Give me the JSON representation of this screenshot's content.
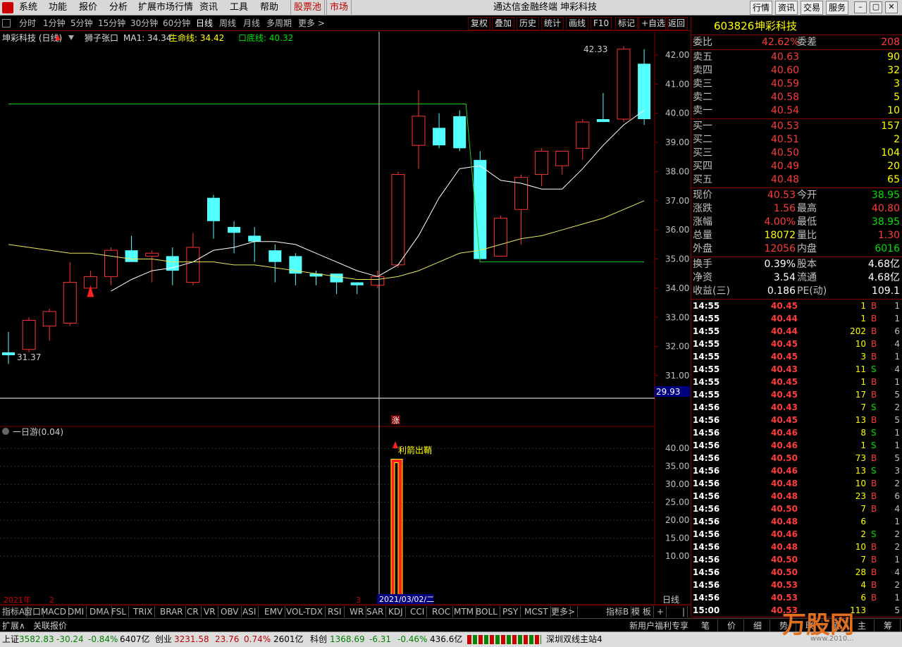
{
  "menu": {
    "items": [
      "系统",
      "功能",
      "报价",
      "分析",
      "扩展市场行情",
      "资讯",
      "工具",
      "帮助"
    ],
    "stock_pool": "股票池",
    "market": "市场",
    "title": "通达信金融终端 坤彩科技",
    "right_buttons": [
      "行情",
      "资讯",
      "交易",
      "服务"
    ]
  },
  "periods": {
    "items": [
      "分时",
      "1分钟",
      "5分钟",
      "15分钟",
      "30分钟",
      "60分钟",
      "日线",
      "周线",
      "月线",
      "多周期",
      "更多 >"
    ],
    "active": "日线",
    "tools": [
      "复权",
      "叠加",
      "历史",
      "统计",
      "画线",
      "F10",
      "标记",
      "+自选",
      "返回"
    ]
  },
  "chart": {
    "legend": {
      "name": "坤彩科技 (日线)",
      "pattern": "狮子张口",
      "ma1": "MA1: 34.34",
      "life": "生命线: 34.42",
      "bottom": "口底线: 40.32"
    },
    "y_ticks": [
      "42.00",
      "41.00",
      "40.00",
      "39.00",
      "38.00",
      "37.00",
      "36.00",
      "35.00",
      "34.00",
      "33.00",
      "32.00",
      "31.00"
    ],
    "high_label": "42.33",
    "low_label": "31.37",
    "cur_price_tag": "29.93",
    "zhang_tag": "涨",
    "sub_legend": "一日游(0.04)",
    "sub_ticks": [
      "40.00",
      "35.00",
      "30.00",
      "25.00",
      "20.00",
      "15.00",
      "10.00"
    ],
    "signal_text": "利箭出鞘",
    "x_labels": {
      "year": "2021年",
      "m2": "2",
      "m3": "3",
      "cursor_date": "2021/03/02/二",
      "period": "日线"
    }
  },
  "chart_data": {
    "type": "candlestick",
    "candles": [
      {
        "o": 31.8,
        "h": 32.5,
        "l": 31.4,
        "c": 31.7
      },
      {
        "o": 31.9,
        "h": 33.0,
        "l": 31.8,
        "c": 32.9
      },
      {
        "o": 32.7,
        "h": 33.3,
        "l": 32.2,
        "c": 33.2
      },
      {
        "o": 32.8,
        "h": 34.9,
        "l": 32.7,
        "c": 34.2
      },
      {
        "o": 34.0,
        "h": 34.6,
        "l": 33.7,
        "c": 34.4
      },
      {
        "o": 34.4,
        "h": 35.4,
        "l": 34.1,
        "c": 35.3
      },
      {
        "o": 35.3,
        "h": 35.8,
        "l": 34.9,
        "c": 34.9
      },
      {
        "o": 35.1,
        "h": 35.3,
        "l": 34.2,
        "c": 35.2
      },
      {
        "o": 35.1,
        "h": 35.4,
        "l": 34.1,
        "c": 34.6
      },
      {
        "o": 34.2,
        "h": 35.9,
        "l": 34.1,
        "c": 35.4
      },
      {
        "o": 37.1,
        "h": 37.2,
        "l": 35.7,
        "c": 36.3
      },
      {
        "o": 36.1,
        "h": 36.3,
        "l": 35.2,
        "c": 35.9
      },
      {
        "o": 35.8,
        "h": 36.1,
        "l": 34.9,
        "c": 35.6
      },
      {
        "o": 35.3,
        "h": 35.5,
        "l": 34.2,
        "c": 34.9
      },
      {
        "o": 35.1,
        "h": 35.2,
        "l": 34.1,
        "c": 34.5
      },
      {
        "o": 34.5,
        "h": 34.6,
        "l": 34.1,
        "c": 34.4
      },
      {
        "o": 34.5,
        "h": 34.5,
        "l": 33.8,
        "c": 34.2
      },
      {
        "o": 34.2,
        "h": 34.2,
        "l": 33.8,
        "c": 34.1
      },
      {
        "o": 34.1,
        "h": 34.6,
        "l": 34.0,
        "c": 34.4
      },
      {
        "o": 34.8,
        "h": 38.0,
        "l": 34.7,
        "c": 37.9
      },
      {
        "o": 38.9,
        "h": 40.8,
        "l": 38.1,
        "c": 39.9
      },
      {
        "o": 39.5,
        "h": 40.0,
        "l": 38.8,
        "c": 38.9
      },
      {
        "o": 39.9,
        "h": 40.1,
        "l": 38.7,
        "c": 38.8
      },
      {
        "o": 38.4,
        "h": 38.7,
        "l": 35.0,
        "c": 35.0
      },
      {
        "o": 35.1,
        "h": 36.5,
        "l": 35.1,
        "c": 36.4
      },
      {
        "o": 36.7,
        "h": 37.9,
        "l": 35.5,
        "c": 37.8
      },
      {
        "o": 37.9,
        "h": 38.8,
        "l": 37.5,
        "c": 38.7
      },
      {
        "o": 38.2,
        "h": 38.7,
        "l": 37.9,
        "c": 38.7
      },
      {
        "o": 38.8,
        "h": 39.8,
        "l": 38.4,
        "c": 39.7
      },
      {
        "o": 39.8,
        "h": 40.7,
        "l": 39.7,
        "c": 39.7
      },
      {
        "o": 39.8,
        "h": 42.3,
        "l": 39.7,
        "c": 42.2
      },
      {
        "o": 41.7,
        "h": 42.2,
        "l": 39.6,
        "c": 39.8
      }
    ],
    "ma_white": [
      null,
      null,
      null,
      null,
      null,
      33.9,
      34.3,
      34.6,
      34.7,
      34.9,
      35.3,
      35.4,
      35.6,
      35.6,
      35.5,
      35.2,
      34.9,
      34.6,
      34.4,
      34.8,
      35.8,
      37.1,
      38.1,
      38.2,
      37.7,
      37.6,
      37.4,
      37.4,
      38.1,
      38.9,
      39.6,
      40.1
    ],
    "ma_yellow": [
      35.5,
      35.4,
      35.3,
      35.2,
      35.2,
      35.1,
      35.0,
      35.0,
      34.9,
      34.9,
      34.9,
      34.8,
      34.8,
      34.7,
      34.6,
      34.5,
      34.4,
      34.3,
      34.3,
      34.4,
      34.6,
      34.9,
      35.2,
      35.3,
      35.5,
      35.7,
      35.8,
      36.0,
      36.2,
      36.4,
      36.7,
      37.0
    ],
    "green_line": {
      "level": 40.32,
      "to_level": 34.9
    },
    "ylim": [
      30.3,
      42.6
    ],
    "sub_bar": {
      "value": 37.0,
      "ylim": [
        0,
        42
      ]
    }
  },
  "quote": {
    "code": "603826",
    "name": "坤彩科技",
    "weibi": {
      "label": "委比",
      "value": "42.62%",
      "diff_label": "委差",
      "diff": "208"
    },
    "asks": [
      {
        "label": "卖五",
        "price": "40.63",
        "vol": "90"
      },
      {
        "label": "卖四",
        "price": "40.60",
        "vol": "32"
      },
      {
        "label": "卖三",
        "price": "40.59",
        "vol": "3"
      },
      {
        "label": "卖二",
        "price": "40.58",
        "vol": "5"
      },
      {
        "label": "卖一",
        "price": "40.54",
        "vol": "10"
      }
    ],
    "bids": [
      {
        "label": "买一",
        "price": "40.53",
        "vol": "157"
      },
      {
        "label": "买二",
        "price": "40.51",
        "vol": "2"
      },
      {
        "label": "买三",
        "price": "40.50",
        "vol": "104"
      },
      {
        "label": "买四",
        "price": "40.49",
        "vol": "20"
      },
      {
        "label": "买五",
        "price": "40.48",
        "vol": "65"
      }
    ],
    "stats": [
      {
        "l1": "现价",
        "v1": "40.53",
        "c1": "red",
        "l2": "今开",
        "v2": "38.95",
        "c2": "green"
      },
      {
        "l1": "涨跌",
        "v1": "1.56",
        "c1": "red",
        "l2": "最高",
        "v2": "40.80",
        "c2": "red"
      },
      {
        "l1": "涨幅",
        "v1": "4.00%",
        "c1": "red",
        "l2": "最低",
        "v2": "38.95",
        "c2": "green"
      },
      {
        "l1": "总量",
        "v1": "18072",
        "c1": "yellow",
        "l2": "量比",
        "v2": "1.30",
        "c2": "red"
      },
      {
        "l1": "外盘",
        "v1": "12056",
        "c1": "red",
        "l2": "内盘",
        "v2": "6016",
        "c2": "green"
      }
    ],
    "fund": [
      {
        "l1": "换手",
        "v1": "0.39%",
        "l2": "股本",
        "v2": "4.68亿"
      },
      {
        "l1": "净资",
        "v1": "3.54",
        "l2": "流通",
        "v2": "4.68亿"
      },
      {
        "l1": "收益(三)",
        "v1": "0.186",
        "l2": "PE(动)",
        "v2": "109.1"
      }
    ],
    "ticks": [
      {
        "t": "14:55",
        "p": "40.45",
        "v": "1",
        "s": "B",
        "n": "1"
      },
      {
        "t": "14:55",
        "p": "40.44",
        "v": "1",
        "s": "B",
        "n": "1"
      },
      {
        "t": "14:55",
        "p": "40.44",
        "v": "202",
        "s": "B",
        "n": "6"
      },
      {
        "t": "14:55",
        "p": "40.45",
        "v": "10",
        "s": "B",
        "n": "4"
      },
      {
        "t": "14:55",
        "p": "40.45",
        "v": "3",
        "s": "B",
        "n": "1"
      },
      {
        "t": "14:55",
        "p": "40.43",
        "v": "11",
        "s": "S",
        "n": "4"
      },
      {
        "t": "14:55",
        "p": "40.45",
        "v": "1",
        "s": "B",
        "n": "1"
      },
      {
        "t": "14:55",
        "p": "40.45",
        "v": "17",
        "s": "B",
        "n": "5"
      },
      {
        "t": "14:56",
        "p": "40.43",
        "v": "7",
        "s": "S",
        "n": "2"
      },
      {
        "t": "14:56",
        "p": "40.45",
        "v": "13",
        "s": "B",
        "n": "5"
      },
      {
        "t": "14:56",
        "p": "40.46",
        "v": "8",
        "s": "S",
        "n": "1"
      },
      {
        "t": "14:56",
        "p": "40.46",
        "v": "1",
        "s": "S",
        "n": "1"
      },
      {
        "t": "14:56",
        "p": "40.50",
        "v": "73",
        "s": "B",
        "n": "5"
      },
      {
        "t": "14:56",
        "p": "40.46",
        "v": "13",
        "s": "S",
        "n": "3"
      },
      {
        "t": "14:56",
        "p": "40.48",
        "v": "10",
        "s": "B",
        "n": "2"
      },
      {
        "t": "14:56",
        "p": "40.48",
        "v": "23",
        "s": "B",
        "n": "6"
      },
      {
        "t": "14:56",
        "p": "40.50",
        "v": "7",
        "s": "B",
        "n": "4"
      },
      {
        "t": "14:56",
        "p": "40.48",
        "v": "6",
        "s": "",
        "n": "1"
      },
      {
        "t": "14:56",
        "p": "40.46",
        "v": "2",
        "s": "S",
        "n": "2"
      },
      {
        "t": "14:56",
        "p": "40.48",
        "v": "10",
        "s": "B",
        "n": "2"
      },
      {
        "t": "14:56",
        "p": "40.50",
        "v": "7",
        "s": "B",
        "n": "1"
      },
      {
        "t": "14:56",
        "p": "40.50",
        "v": "28",
        "s": "B",
        "n": "4"
      },
      {
        "t": "14:56",
        "p": "40.53",
        "v": "4",
        "s": "B",
        "n": "2"
      },
      {
        "t": "14:56",
        "p": "40.53",
        "v": "6",
        "s": "B",
        "n": "1"
      },
      {
        "t": "15:00",
        "p": "40.53",
        "v": "113",
        "s": "",
        "n": "5"
      }
    ],
    "tabs": [
      "笔",
      "价",
      "细",
      "势",
      "联",
      "值",
      "主",
      "筹"
    ]
  },
  "indicators": {
    "items": [
      "指标A",
      "窗口",
      "MACD",
      "DMI",
      "DMA",
      "FSL",
      "TRIX",
      "BRAR",
      "CR",
      "VR",
      "OBV",
      "ASI",
      "EMV",
      "VOL-TDX",
      "RSI",
      "WR",
      "SAR",
      "KDJ",
      "CCI",
      "ROC",
      "MTM",
      "BOLL",
      "PSY",
      "MCST",
      "更多",
      ">",
      "指标B",
      "模 板",
      "+",
      "|"
    ]
  },
  "ext": {
    "a": "扩展∧",
    "b": "关联报价",
    "promo": "新用户福利专享"
  },
  "status": {
    "sh": {
      "name": "上证",
      "val": "3582.83",
      "chg": "-30.24",
      "pct": "-0.84%",
      "amt": "6407亿"
    },
    "cy": {
      "name": "创业",
      "val": "3231.58",
      "chg": "23.76",
      "pct": "0.74%",
      "amt": "2601亿"
    },
    "kc": {
      "name": "科创",
      "val": "1368.69",
      "chg": "-6.31",
      "pct": "-0.46%",
      "amt": "436.6亿"
    },
    "server": "深圳双线主站4",
    "watermark": "万股网",
    "watermark_url": "www.2010..."
  }
}
